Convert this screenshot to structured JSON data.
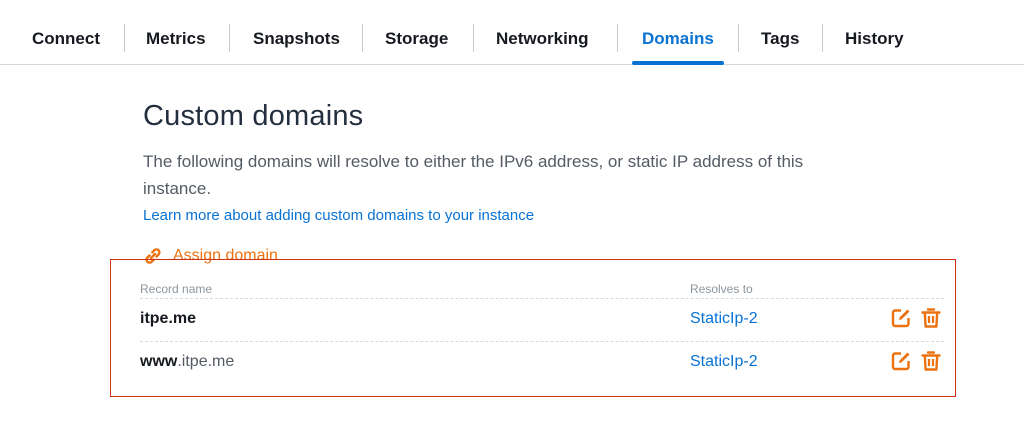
{
  "tabs": [
    {
      "label": "Connect",
      "active": false
    },
    {
      "label": "Metrics",
      "active": false
    },
    {
      "label": "Snapshots",
      "active": false
    },
    {
      "label": "Storage",
      "active": false
    },
    {
      "label": "Networking",
      "active": false
    },
    {
      "label": "Domains",
      "active": true
    },
    {
      "label": "Tags",
      "active": false
    },
    {
      "label": "History",
      "active": false
    }
  ],
  "section": {
    "title": "Custom domains",
    "description": "The following domains will resolve to either the IPv6 address, or static IP address of this instance.",
    "learn_more_link": "Learn more about adding custom domains to your instance",
    "assign_button": "Assign domain",
    "assign_icon": "link-icon"
  },
  "table": {
    "columns": [
      "Record name",
      "Resolves to"
    ],
    "rows": [
      {
        "name_prefix": "",
        "name_domain": "itpe.me",
        "resolves_to": "StaticIp-2"
      },
      {
        "name_prefix": "www",
        "name_domain": ".itpe.me",
        "resolves_to": "StaticIp-2"
      }
    ],
    "row_actions": [
      "edit-icon",
      "trash-icon"
    ]
  },
  "colors": {
    "accent_blue": "#0972d3",
    "accent_orange": "#ec7211",
    "highlight_red": "#d13212"
  }
}
